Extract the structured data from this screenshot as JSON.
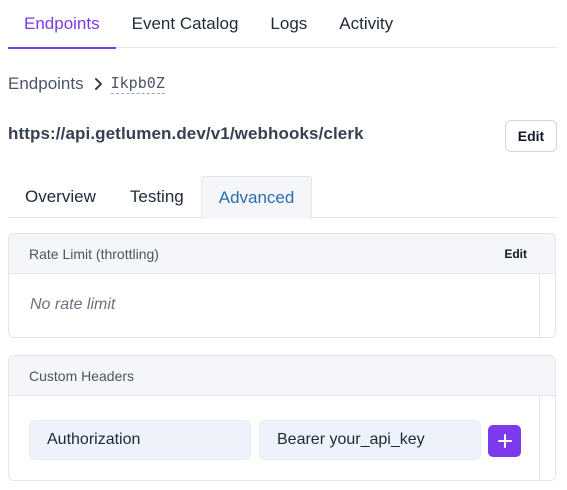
{
  "nav": {
    "tabs": [
      {
        "label": "Endpoints"
      },
      {
        "label": "Event Catalog"
      },
      {
        "label": "Logs"
      },
      {
        "label": "Activity"
      }
    ],
    "active_tab": "Endpoints"
  },
  "breadcrumb": {
    "parent": "Endpoints",
    "current": "Ikpb0Z"
  },
  "endpoint": {
    "url": "https://api.getlumen.dev/v1/webhooks/clerk",
    "edit_label": "Edit"
  },
  "subtabs": {
    "tabs": [
      {
        "label": "Overview"
      },
      {
        "label": "Testing"
      },
      {
        "label": "Advanced"
      }
    ],
    "active_tab": "Advanced"
  },
  "rate_limit": {
    "title": "Rate Limit (throttling)",
    "edit_label": "Edit",
    "value": "No rate limit"
  },
  "custom_headers": {
    "title": "Custom Headers",
    "key_value": "Authorization",
    "value_value": "Bearer your_api_key",
    "add_icon": "plus-icon"
  },
  "colors": {
    "accent": "#7c3aed",
    "active_subtab": "#2b6cb0",
    "card_header_bg": "#f4f6f9",
    "input_bg": "#edf2fb"
  }
}
